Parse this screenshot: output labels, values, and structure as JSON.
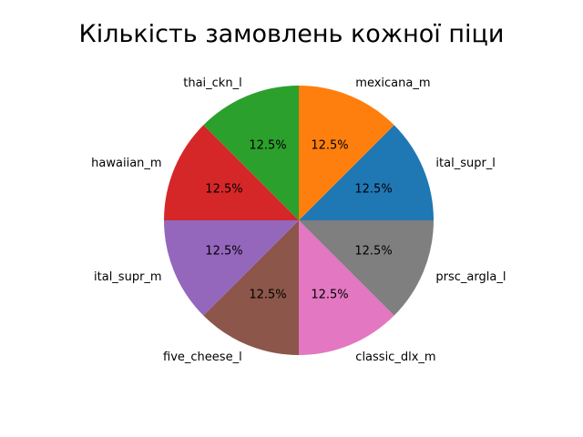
{
  "chart_data": {
    "type": "pie",
    "title": "Кількість замовлень кожної піци",
    "categories": [
      "ital_supr_l",
      "mexicana_m",
      "thai_ckn_l",
      "hawaiian_m",
      "ital_supr_m",
      "five_cheese_l",
      "classic_dlx_m",
      "prsc_argla_l"
    ],
    "values": [
      1,
      1,
      1,
      1,
      1,
      1,
      1,
      1
    ],
    "percent_labels": [
      "12.5%",
      "12.5%",
      "12.5%",
      "12.5%",
      "12.5%",
      "12.5%",
      "12.5%",
      "12.5%"
    ],
    "colors": [
      "#1f77b4",
      "#ff7f0e",
      "#2ca02c",
      "#d62728",
      "#9467bd",
      "#8c564b",
      "#e377c2",
      "#7f7f7f"
    ],
    "start_angle_deg": 0,
    "direction": "counterclockwise"
  }
}
